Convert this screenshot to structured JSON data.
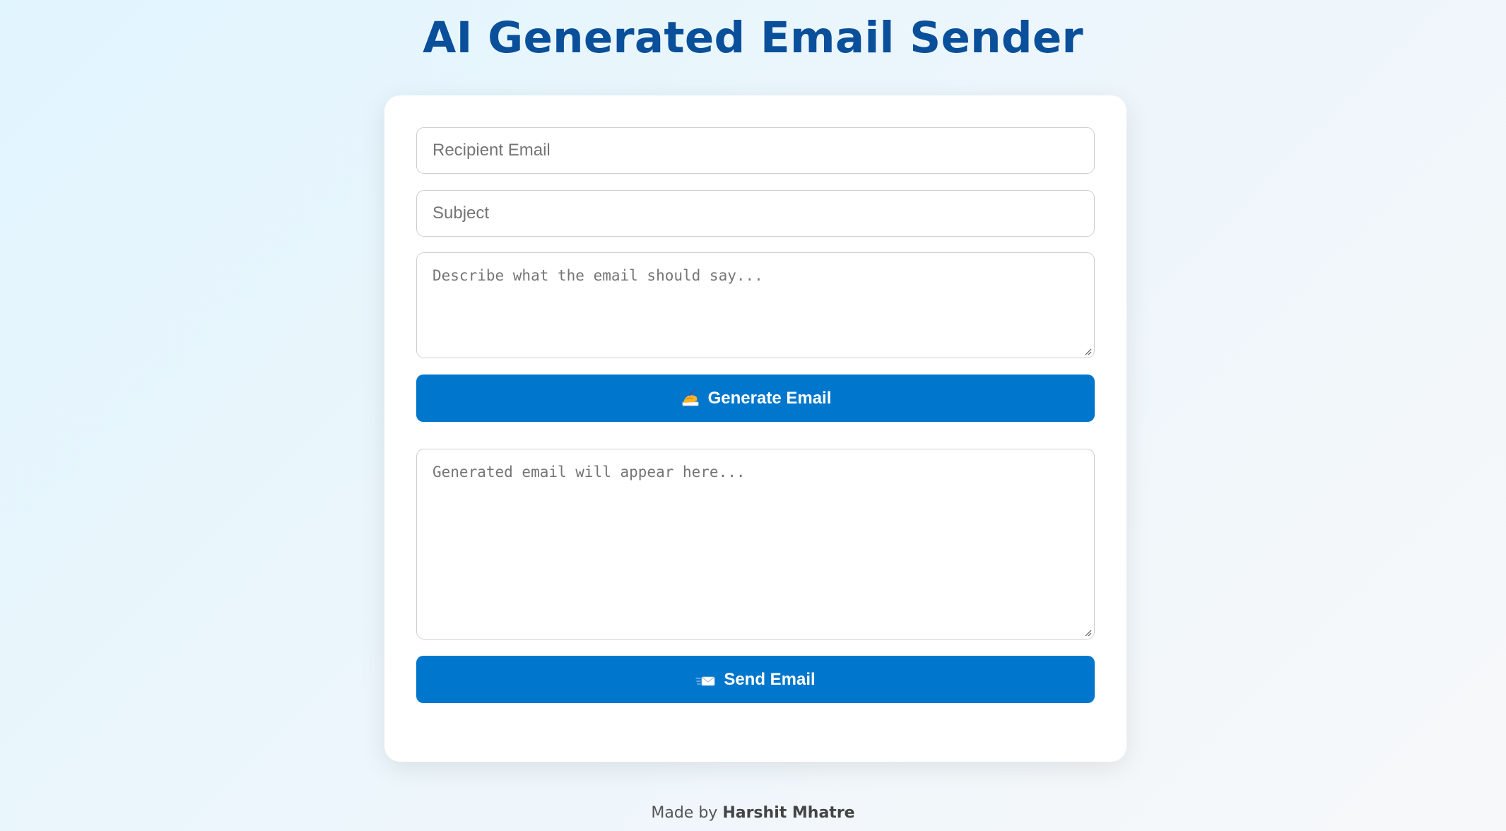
{
  "header": {
    "title": "AI Generated Email Sender"
  },
  "form": {
    "recipient_placeholder": "Recipient Email",
    "subject_placeholder": "Subject",
    "prompt_placeholder": "Describe what the email should say...",
    "generate_button": {
      "icon": "writing-hand-icon",
      "label": "Generate Email"
    },
    "output_placeholder": "Generated email will appear here...",
    "send_button": {
      "icon": "send-envelope-icon",
      "label": "Send Email"
    }
  },
  "footer": {
    "prefix": "Made by",
    "author": "Harshit Mhatre"
  },
  "colors": {
    "title": "#0a4f9a",
    "button": "#0077cc",
    "background": "#e1f5fe",
    "card": "#ffffff"
  }
}
